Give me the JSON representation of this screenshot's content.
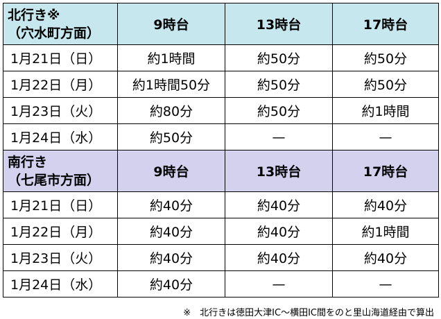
{
  "sections": [
    {
      "header_line1": "北行き※",
      "header_line2": "（穴水町方面）",
      "columns": [
        "9時台",
        "13時台",
        "17時台"
      ],
      "rows": [
        {
          "date": "1月21日（日）",
          "values": [
            "約1時間",
            "約50分",
            "約50分"
          ]
        },
        {
          "date": "1月22日（月）",
          "values": [
            "約1時間50分",
            "約50分",
            "約50分"
          ]
        },
        {
          "date": "1月23日（火）",
          "values": [
            "約80分",
            "約50分",
            "約1時間"
          ]
        },
        {
          "date": "1月24日（水）",
          "values": [
            "約50分",
            "—",
            "—"
          ]
        }
      ]
    },
    {
      "header_line1": "南行き",
      "header_line2": "（七尾市方面）",
      "columns": [
        "9時台",
        "13時台",
        "17時台"
      ],
      "rows": [
        {
          "date": "1月21日（日）",
          "values": [
            "約40分",
            "約40分",
            "約40分"
          ]
        },
        {
          "date": "1月22日（月）",
          "values": [
            "約40分",
            "約40分",
            "約1時間"
          ]
        },
        {
          "date": "1月23日（火）",
          "values": [
            "約40分",
            "約40分",
            "約40分"
          ]
        },
        {
          "date": "1月24日（水）",
          "values": [
            "約40分",
            "—",
            "—"
          ]
        }
      ]
    }
  ],
  "footnote": "※　北行きは徳田大津IC～横田IC間をのと里山海道経由で算出",
  "colors": {
    "north_header": "#c6e7ee",
    "south_header": "#d4d1ef"
  }
}
